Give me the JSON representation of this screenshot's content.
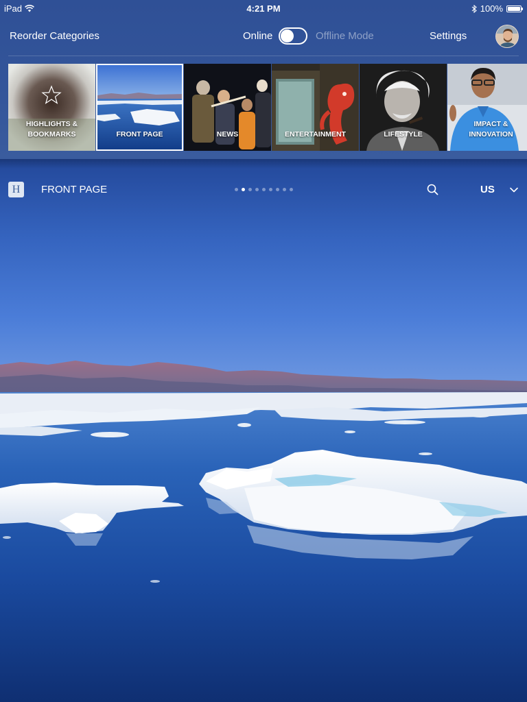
{
  "status_bar": {
    "device": "iPad",
    "time": "4:21 PM",
    "battery": "100%",
    "battery_level": 1.0
  },
  "toolbar": {
    "reorder_label": "Reorder Categories",
    "online_label": "Online",
    "offline_label": "Offline Mode",
    "settings_label": "Settings"
  },
  "categories": [
    {
      "label": "HIGHLIGHTS &\nBOOKMARKS",
      "icon": "star-icon"
    },
    {
      "label": "FRONT PAGE",
      "selected": true
    },
    {
      "label": "NEWS"
    },
    {
      "label": "ENTERTAINMENT"
    },
    {
      "label": "LIFESTYLE"
    },
    {
      "label": "IMPACT &\nINNOVATION"
    }
  ],
  "section": {
    "logo_letter": "H",
    "title": "FRONT PAGE",
    "page_count": 9,
    "active_page": 2,
    "region": "US"
  },
  "colors": {
    "drawer": "#33559a",
    "sky": "#4a7ad6",
    "water": "#1d4fa8",
    "ice": "#f4f7fb"
  }
}
